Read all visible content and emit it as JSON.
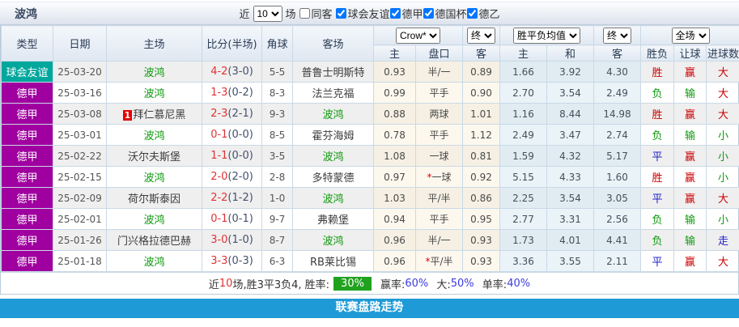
{
  "header": {
    "team_name": "波鸿",
    "recent_label": "近",
    "matches_count": "10",
    "matches_label": "场",
    "same_away_label": "同客",
    "filters": [
      {
        "label": "球会友谊",
        "checked": true
      },
      {
        "label": "德甲",
        "checked": true
      },
      {
        "label": "德国杯",
        "checked": true
      },
      {
        "label": "德乙",
        "checked": true
      }
    ]
  },
  "table": {
    "base_headers": [
      "类型",
      "日期",
      "主场",
      "比分(半场)",
      "角球",
      "客场"
    ],
    "odds_company": "Crow*",
    "odds_final": "终",
    "mean_label": "胜平负均值",
    "mean_final": "终",
    "scope_label": "全场",
    "sub_headers": [
      "主",
      "盘口",
      "客",
      "主",
      "和",
      "客",
      "胜负",
      "让球",
      "进球数"
    ],
    "rows": [
      {
        "type": "球会友谊",
        "type_class": "teal",
        "date": "25-03-20",
        "home": "波鸿",
        "home_class": "focus",
        "home_badge": "",
        "score": "4-2",
        "half": "(3-0)",
        "corner": "5-5",
        "away": "普鲁士明斯特",
        "away_class": "",
        "odds_home": "0.93",
        "handicap_star": "",
        "handicap": "半/一",
        "odds_away": "0.89",
        "mean_home": "1.66",
        "mean_draw": "3.92",
        "mean_away": "4.30",
        "result": "胜",
        "result_class": "c-red",
        "cover": "赢",
        "cover_class": "c-red",
        "goals": "大",
        "goals_class": "c-red"
      },
      {
        "type": "德甲",
        "type_class": "purple",
        "date": "25-03-16",
        "home": "波鸿",
        "home_class": "focus",
        "home_badge": "",
        "score": "1-3",
        "half": "(0-2)",
        "corner": "8-3",
        "away": "法兰克福",
        "away_class": "",
        "odds_home": "0.99",
        "handicap_star": "",
        "handicap": "平手",
        "odds_away": "0.90",
        "mean_home": "2.70",
        "mean_draw": "3.54",
        "mean_away": "2.49",
        "result": "负",
        "result_class": "c-green",
        "cover": "输",
        "cover_class": "c-green",
        "goals": "大",
        "goals_class": "c-red"
      },
      {
        "type": "德甲",
        "type_class": "purple",
        "date": "25-03-08",
        "home": "拜仁慕尼黑",
        "home_class": "",
        "home_badge": "1",
        "score": "2-3",
        "half": "(2-1)",
        "corner": "9-3",
        "away": "波鸿",
        "away_class": "focus",
        "odds_home": "0.88",
        "handicap_star": "",
        "handicap": "两球",
        "odds_away": "1.01",
        "mean_home": "1.16",
        "mean_draw": "8.44",
        "mean_away": "14.98",
        "result": "胜",
        "result_class": "c-red",
        "cover": "赢",
        "cover_class": "c-red",
        "goals": "大",
        "goals_class": "c-red"
      },
      {
        "type": "德甲",
        "type_class": "purple",
        "date": "25-03-01",
        "home": "波鸿",
        "home_class": "focus",
        "home_badge": "",
        "score": "0-1",
        "half": "(0-0)",
        "corner": "8-5",
        "away": "霍芬海姆",
        "away_class": "",
        "odds_home": "0.78",
        "handicap_star": "",
        "handicap": "平手",
        "odds_away": "1.12",
        "mean_home": "2.49",
        "mean_draw": "3.47",
        "mean_away": "2.74",
        "result": "负",
        "result_class": "c-green",
        "cover": "输",
        "cover_class": "c-green",
        "goals": "小",
        "goals_class": "c-green"
      },
      {
        "type": "德甲",
        "type_class": "purple",
        "date": "25-02-22",
        "home": "沃尔夫斯堡",
        "home_class": "",
        "home_badge": "",
        "score": "1-1",
        "half": "(0-0)",
        "corner": "3-5",
        "away": "波鸿",
        "away_class": "focus",
        "odds_home": "1.08",
        "handicap_star": "",
        "handicap": "一球",
        "odds_away": "0.81",
        "mean_home": "1.59",
        "mean_draw": "4.32",
        "mean_away": "5.17",
        "result": "平",
        "result_class": "c-blue",
        "cover": "赢",
        "cover_class": "c-red",
        "goals": "小",
        "goals_class": "c-green"
      },
      {
        "type": "德甲",
        "type_class": "purple",
        "date": "25-02-15",
        "home": "波鸿",
        "home_class": "focus",
        "home_badge": "",
        "score": "2-0",
        "half": "(2-0)",
        "corner": "2-8",
        "away": "多特蒙德",
        "away_class": "",
        "odds_home": "0.97",
        "handicap_star": "*",
        "handicap": "一球",
        "odds_away": "0.92",
        "mean_home": "5.15",
        "mean_draw": "4.33",
        "mean_away": "1.60",
        "result": "胜",
        "result_class": "c-red",
        "cover": "赢",
        "cover_class": "c-red",
        "goals": "小",
        "goals_class": "c-green"
      },
      {
        "type": "德甲",
        "type_class": "purple",
        "date": "25-02-09",
        "home": "荷尔斯泰因",
        "home_class": "",
        "home_badge": "",
        "score": "2-2",
        "half": "(1-2)",
        "corner": "1-0",
        "away": "波鸿",
        "away_class": "focus",
        "odds_home": "1.03",
        "handicap_star": "",
        "handicap": "平/半",
        "odds_away": "0.86",
        "mean_home": "2.25",
        "mean_draw": "3.54",
        "mean_away": "3.05",
        "result": "平",
        "result_class": "c-blue",
        "cover": "赢",
        "cover_class": "c-red",
        "goals": "大",
        "goals_class": "c-red"
      },
      {
        "type": "德甲",
        "type_class": "purple",
        "date": "25-02-01",
        "home": "波鸿",
        "home_class": "focus",
        "home_badge": "",
        "score": "0-1",
        "half": "(0-1)",
        "corner": "9-7",
        "away": "弗赖堡",
        "away_class": "",
        "odds_home": "0.94",
        "handicap_star": "",
        "handicap": "平手",
        "odds_away": "0.95",
        "mean_home": "2.77",
        "mean_draw": "3.31",
        "mean_away": "2.56",
        "result": "负",
        "result_class": "c-green",
        "cover": "输",
        "cover_class": "c-green",
        "goals": "小",
        "goals_class": "c-green"
      },
      {
        "type": "德甲",
        "type_class": "purple",
        "date": "25-01-26",
        "home": "门兴格拉德巴赫",
        "home_class": "",
        "home_badge": "",
        "score": "3-0",
        "half": "(1-0)",
        "corner": "8-7",
        "away": "波鸿",
        "away_class": "focus",
        "odds_home": "0.96",
        "handicap_star": "",
        "handicap": "半/一",
        "odds_away": "0.93",
        "mean_home": "1.73",
        "mean_draw": "4.01",
        "mean_away": "4.41",
        "result": "负",
        "result_class": "c-green",
        "cover": "输",
        "cover_class": "c-green",
        "goals": "走",
        "goals_class": "c-blue"
      },
      {
        "type": "德甲",
        "type_class": "purple",
        "date": "25-01-18",
        "home": "波鸿",
        "home_class": "focus",
        "home_badge": "",
        "score": "3-3",
        "half": "(0-3)",
        "corner": "6-3",
        "away": "RB莱比锡",
        "away_class": "",
        "odds_home": "0.96",
        "handicap_star": "*",
        "handicap": "平/半",
        "odds_away": "0.93",
        "mean_home": "3.36",
        "mean_draw": "3.55",
        "mean_away": "2.11",
        "result": "平",
        "result_class": "c-blue",
        "cover": "赢",
        "cover_class": "c-red",
        "goals": "大",
        "goals_class": "c-red"
      }
    ]
  },
  "summary": {
    "prefix": "近",
    "count": "10",
    "mid": "场,胜3平3负4, 胜率:",
    "win_rate": "30%",
    "label_win": "赢率:",
    "win_pct": "60%",
    "label_big": " 大:",
    "big_pct": "50%",
    "label_single": " 单率:",
    "single_pct": "40%"
  },
  "footer_bar": {
    "label": "联赛盘路走势"
  },
  "colors": {
    "friendly_badge": "#00a79c",
    "bundesliga_badge": "#a000a0",
    "focus_team": "#0f9a0f",
    "score_red": "#e03333",
    "win_red": "#cc0000",
    "lose_green": "#0f9a0f",
    "draw_blue": "#2222cc",
    "rate_badge_green": "#21a21f",
    "bottom_bar_blue": "#1e9ad7"
  }
}
